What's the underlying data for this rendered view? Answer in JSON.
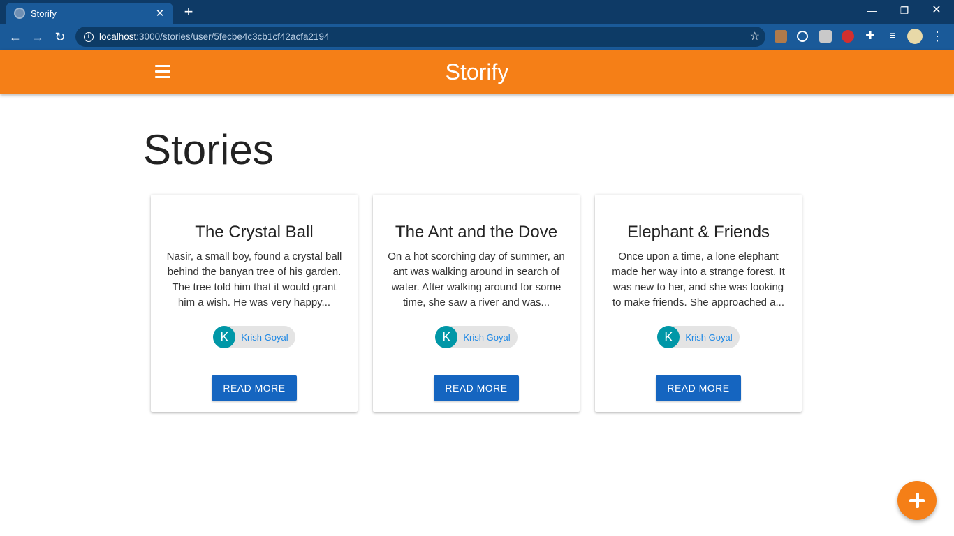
{
  "browser": {
    "tab_title": "Storify",
    "url_host": "localhost",
    "url_path": ":3000/stories/user/5fecbe4c3cb1cf42acfa2194"
  },
  "appbar": {
    "brand": "Storify"
  },
  "page": {
    "title": "Stories"
  },
  "stories": [
    {
      "title": "The Crystal Ball",
      "excerpt": "Nasir, a small boy, found a crystal ball behind the banyan tree of his garden. The tree told him that it would grant him a wish. He was very happy...",
      "author_initial": "K",
      "author": "Krish Goyal",
      "button": "READ MORE"
    },
    {
      "title": "The Ant and the Dove",
      "excerpt": "On a hot scorching day of summer, an ant was walking around in search of water. After walking around for some time, she saw a river and was...",
      "author_initial": "K",
      "author": "Krish Goyal",
      "button": "READ MORE"
    },
    {
      "title": "Elephant & Friends",
      "excerpt": "Once upon a time, a lone elephant made her way into a strange forest. It was new to her, and she was looking to make friends. She approached a...",
      "author_initial": "K",
      "author": "Krish Goyal",
      "button": "READ MORE"
    }
  ],
  "colors": {
    "primary": "#f57f17",
    "button": "#1565c0",
    "avatar": "#0097a7",
    "author_link": "#1e88e5"
  },
  "icons": {
    "menu": "hamburger-icon",
    "fab": "plus-icon"
  }
}
